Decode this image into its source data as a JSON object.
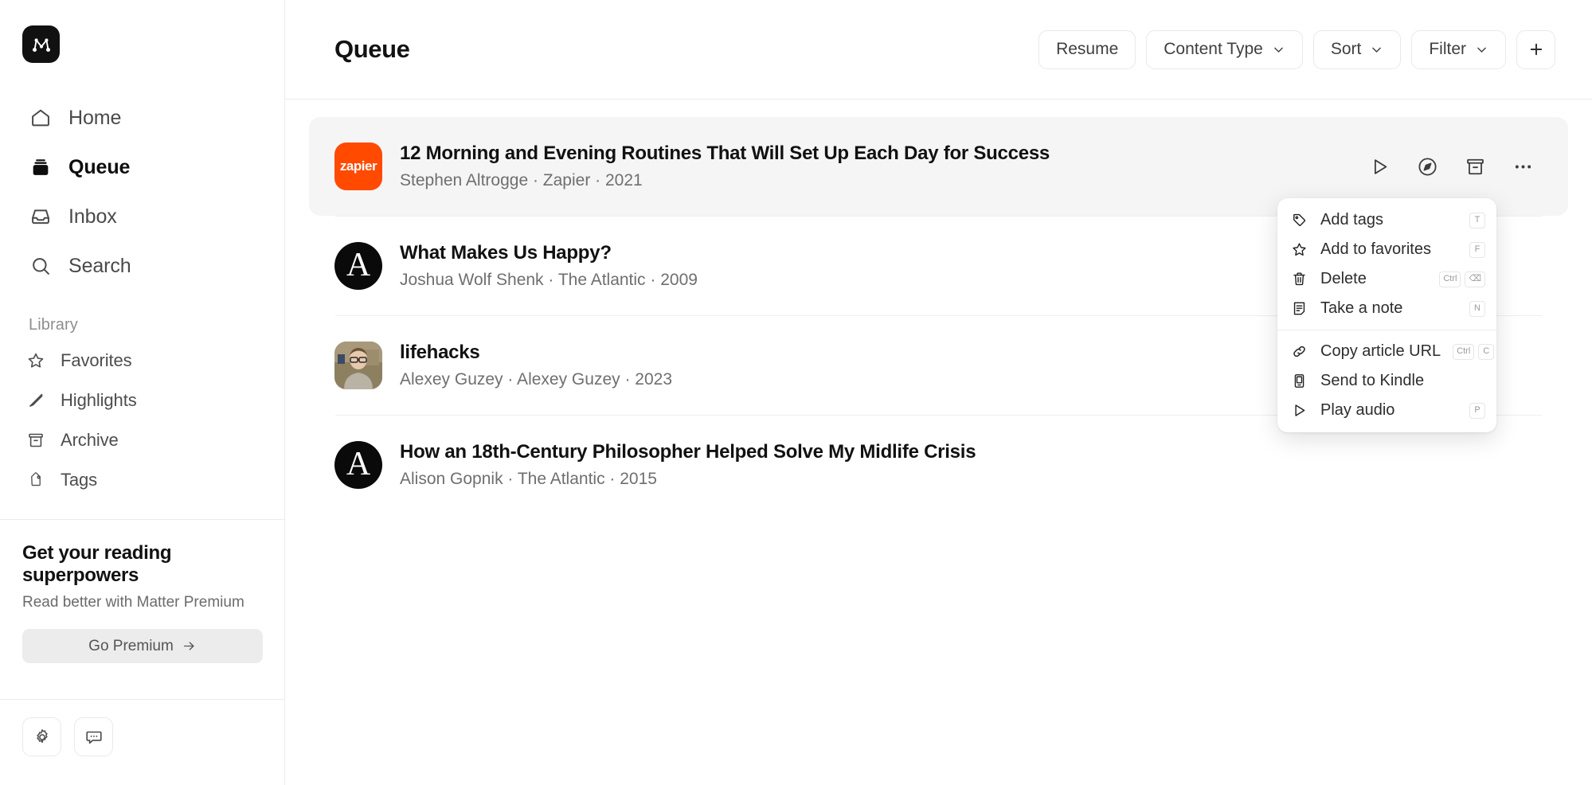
{
  "app": {
    "logo_icon": "matter-logo-icon"
  },
  "sidebar": {
    "primary": [
      {
        "label": "Home",
        "icon": "home-icon",
        "active": false
      },
      {
        "label": "Queue",
        "icon": "queue-icon",
        "active": true
      },
      {
        "label": "Inbox",
        "icon": "inbox-icon",
        "active": false
      },
      {
        "label": "Search",
        "icon": "search-icon",
        "active": false
      }
    ],
    "library_label": "Library",
    "library": [
      {
        "label": "Favorites",
        "icon": "star-icon"
      },
      {
        "label": "Highlights",
        "icon": "pen-icon"
      },
      {
        "label": "Archive",
        "icon": "archive-icon"
      },
      {
        "label": "Tags",
        "icon": "tag-icon"
      }
    ],
    "promo": {
      "title": "Get your reading superpowers",
      "subtitle": "Read better with Matter Premium",
      "button_label": "Go Premium",
      "button_icon": "arrow-right-icon"
    },
    "footer": [
      {
        "icon": "gear-icon",
        "name": "settings-button"
      },
      {
        "icon": "message-icon",
        "name": "feedback-button"
      }
    ]
  },
  "header": {
    "title": "Queue",
    "actions": [
      {
        "label": "Resume",
        "icon": null,
        "name": "resume-button"
      },
      {
        "label": "Content Type",
        "icon": "chevron-down-icon",
        "name": "content-type-button"
      },
      {
        "label": "Sort",
        "icon": "chevron-down-icon",
        "name": "sort-button"
      },
      {
        "label": "Filter",
        "icon": "chevron-down-icon",
        "name": "filter-button"
      },
      {
        "label": "",
        "icon": "plus-icon",
        "name": "add-button"
      }
    ]
  },
  "list": {
    "items": [
      {
        "title": "12 Morning and Evening Routines That Will Set Up Each Day for Success",
        "author": "Stephen Altrogge",
        "publication": "Zapier",
        "year": "2021",
        "meta": "Stephen Altrogge · Zapier · 2021",
        "thumb_kind": "zapier",
        "thumb_text": "zapier",
        "selected": true
      },
      {
        "title": "What Makes Us Happy?",
        "author": "Joshua Wolf Shenk",
        "publication": "The Atlantic",
        "year": "2009",
        "meta": "Joshua Wolf Shenk · The Atlantic · 2009",
        "thumb_kind": "atlantic",
        "thumb_text": "A",
        "selected": false
      },
      {
        "title": "lifehacks",
        "author": "Alexey Guzey",
        "publication": "Alexey Guzey",
        "year": "2023",
        "meta": "Alexey Guzey · Alexey Guzey · 2023",
        "thumb_kind": "photo",
        "thumb_text": "",
        "selected": false
      },
      {
        "title": "How an 18th-Century Philosopher Helped Solve My Midlife Crisis",
        "author": "Alison Gopnik",
        "publication": "The Atlantic",
        "year": "2015",
        "meta": "Alison Gopnik · The Atlantic · 2015",
        "thumb_kind": "atlantic",
        "thumb_text": "A",
        "selected": false
      }
    ],
    "row_actions": [
      {
        "icon": "play-icon",
        "name": "play-audio-action"
      },
      {
        "icon": "compass-icon",
        "name": "discover-action"
      },
      {
        "icon": "archive-icon",
        "name": "archive-action"
      },
      {
        "icon": "more-icon",
        "name": "more-options-action"
      }
    ]
  },
  "context_menu": {
    "group1": [
      {
        "label": "Add tags",
        "icon": "tag-icon",
        "keys": [
          "T"
        ]
      },
      {
        "label": "Add to favorites",
        "icon": "star-icon",
        "keys": [
          "F"
        ]
      },
      {
        "label": "Delete",
        "icon": "trash-icon",
        "keys": [
          "Ctrl",
          "⌫"
        ]
      },
      {
        "label": "Take a note",
        "icon": "note-icon",
        "keys": [
          "N"
        ]
      }
    ],
    "group2": [
      {
        "label": "Copy article URL",
        "icon": "link-icon",
        "keys": [
          "Ctrl",
          "C"
        ]
      },
      {
        "label": "Send to Kindle",
        "icon": "kindle-icon",
        "keys": []
      },
      {
        "label": "Play audio",
        "icon": "play-icon",
        "keys": [
          "P"
        ]
      }
    ]
  },
  "colors": {
    "accent_zapier": "#FF4A00",
    "logo_bg": "#111111",
    "selected_row_bg": "#F5F5F5",
    "border": "#EBEBEB"
  }
}
